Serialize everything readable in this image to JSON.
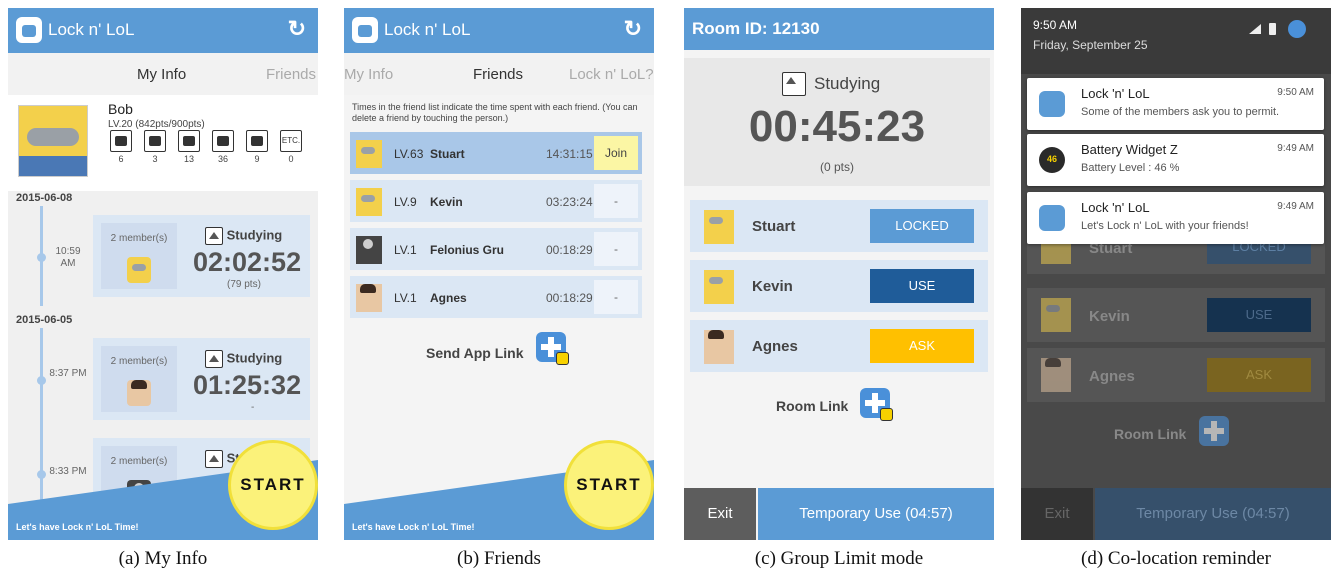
{
  "app": {
    "title": "Lock n' LoL"
  },
  "tabs_a": {
    "my_info": "My Info",
    "friends": "Friends"
  },
  "tabs_b": {
    "my_info": "My Info",
    "friends": "Friends",
    "lock": "Lock n' LoL?"
  },
  "profile": {
    "name": "Bob",
    "level": "LV.20 (842pts/900pts)",
    "stats": [
      {
        "icon": "studying-icon",
        "count": "6"
      },
      {
        "icon": "meeting-icon",
        "count": "3"
      },
      {
        "icon": "dining-icon",
        "count": "13"
      },
      {
        "icon": "chat-icon",
        "count": "36"
      },
      {
        "icon": "couple-icon",
        "count": "9"
      },
      {
        "icon": "etc-icon",
        "label": "ETC.",
        "count": "0"
      }
    ]
  },
  "timeline": [
    {
      "date": "2015-06-08",
      "time": "10:59 AM",
      "members": "2 member(s)",
      "activity": "Studying",
      "duration": "02:02:52",
      "points": "(79 pts)"
    },
    {
      "date": "2015-06-05",
      "time": "8:37 PM",
      "members": "2 member(s)",
      "activity": "Studying",
      "duration": "01:25:32",
      "points": "-"
    },
    {
      "time": "8:33 PM",
      "members": "2 member(s)",
      "activity": "Stu"
    }
  ],
  "banner": {
    "text": "Let's have Lock n' LoL Time!",
    "start": "START"
  },
  "friends": {
    "hint": "Times in the friend list indicate the time spent with each friend. (You can delete a friend by touching the person.)",
    "list": [
      {
        "level": "LV.63",
        "name": "Stuart",
        "time": "14:31:15",
        "action": "Join"
      },
      {
        "level": "LV.9",
        "name": "Kevin",
        "time": "03:23:24",
        "action": "-"
      },
      {
        "level": "LV.1",
        "name": "Felonius Gru",
        "time": "00:18:29",
        "action": "-"
      },
      {
        "level": "LV.1",
        "name": "Agnes",
        "time": "00:18:29",
        "action": "-"
      }
    ],
    "send_link": "Send App Link"
  },
  "room": {
    "id": "Room ID: 12130",
    "activity": "Studying",
    "timer": "00:45:23",
    "points": "(0 pts)",
    "members": [
      {
        "name": "Stuart",
        "status": "LOCKED"
      },
      {
        "name": "Kevin",
        "status": "USE"
      },
      {
        "name": "Agnes",
        "status": "ASK"
      }
    ],
    "link": "Room Link",
    "exit": "Exit",
    "temp": "Temporary Use (04:57)"
  },
  "notifications": {
    "time": "9:50 AM",
    "date": "Friday, September 25",
    "items": [
      {
        "title": "Lock 'n' LoL",
        "text": "Some of the members ask you to permit.",
        "time": "9:50 AM"
      },
      {
        "title": "Battery Widget Z",
        "text": "Battery Level : 46 %",
        "time": "9:49 AM",
        "badge": "46"
      },
      {
        "title": "Lock 'n' LoL",
        "text": "Let's Lock n' LoL with your friends!",
        "time": "9:49 AM"
      }
    ]
  },
  "captions": [
    "(a) My Info",
    "(b) Friends",
    "(c) Group Limit mode",
    "(d) Co-location reminder"
  ],
  "colors": {
    "primary": "#5b9bd5",
    "locked": "#5b9bd5",
    "use": "#1f5c99",
    "ask": "#ffc000",
    "start": "#fbf27a"
  }
}
